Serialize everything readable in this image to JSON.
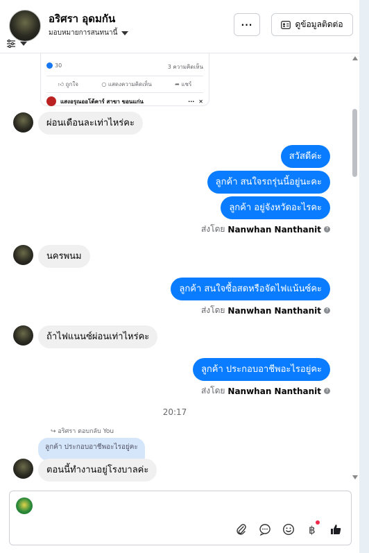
{
  "header": {
    "name": "อริศรา อุดมกัน",
    "assign_label": "มอบหมายการสนทนานี้",
    "more_label": "···",
    "contact_label": "ดูข้อมูลติดต่อ"
  },
  "post_preview": {
    "like_count": "30",
    "comment_count": "3 ความคิดเห็น",
    "like_label": "ถูกใจ",
    "comment_label": "แสดงความคิดเห็น",
    "share_label": "แชร์",
    "page_name": "แสงอรุณออโต้คาร์ สาขา ขอนแก่น",
    "more_label": "···",
    "close_label": "✕"
  },
  "messages": {
    "in1": "ผ่อนเดือนละเท่าไหร่คะ",
    "out1": "สวัสดีค่ะ",
    "out2": "ลูกค้า สนใจรถรุ่นนี้อยู่นะคะ",
    "out3": "ลูกค้า  อยู่จังหวัดอะไรคะ",
    "sent_prefix": "ส่งโดย",
    "sender": "Nanwhan Nanthanit",
    "in2": "นครพนม",
    "out4": "ลูกค้า  สนใจซื้อสดหรือจัดไฟแน้นซ์คะ",
    "in3": "ถ้าไฟแนนซ์ผ่อนเท่าไหร่คะ",
    "out5": "ลูกค้า ประกอบอาชีพอะไรอยู่คะ",
    "time": "20:17",
    "reply_header": "อริศรา ตอบกลับ You",
    "quoted": "ลูกค้า ประกอบอาชีพอะไรอยู่คะ",
    "in4": "ตอนนี้ทำงานอยู่โรงบาลค่ะ"
  },
  "colors": {
    "accent": "#0a7cff",
    "incoming_bg": "#f0f0f0",
    "quote_bg": "#d5e6fb"
  },
  "composer": {
    "icons": [
      "attach-icon",
      "chat-bubble-icon",
      "emoji-icon",
      "currency-icon",
      "thumbs-up-icon"
    ]
  }
}
